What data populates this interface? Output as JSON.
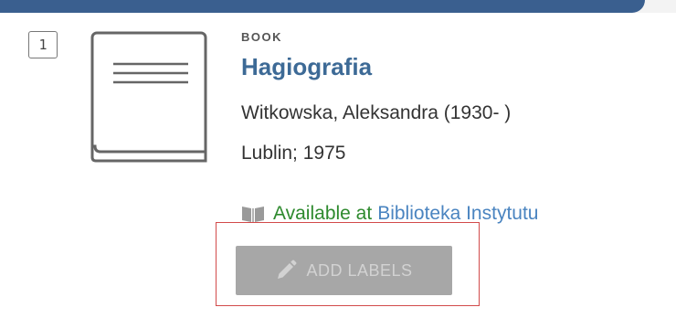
{
  "result": {
    "number": "1",
    "thumbnail_icon": "book-icon",
    "type": "BOOK",
    "title": "Hagiografia",
    "author": "Witkowska, Aleksandra (1930- )",
    "publication": "Lublin; 1975",
    "availability": {
      "icon": "open-book-icon",
      "status": "Available at",
      "location": "Biblioteka Instytutu"
    }
  },
  "actions": {
    "add_labels": {
      "label": "ADD LABELS",
      "icon": "pencil-icon",
      "enabled": false
    }
  },
  "colors": {
    "header_band": "#3a5f8f",
    "title": "#3d6a96",
    "available": "#2e8a2e",
    "location_link": "#4a84c0",
    "focus_outline": "#d24a4a",
    "disabled_button": "#a7a7a7"
  }
}
